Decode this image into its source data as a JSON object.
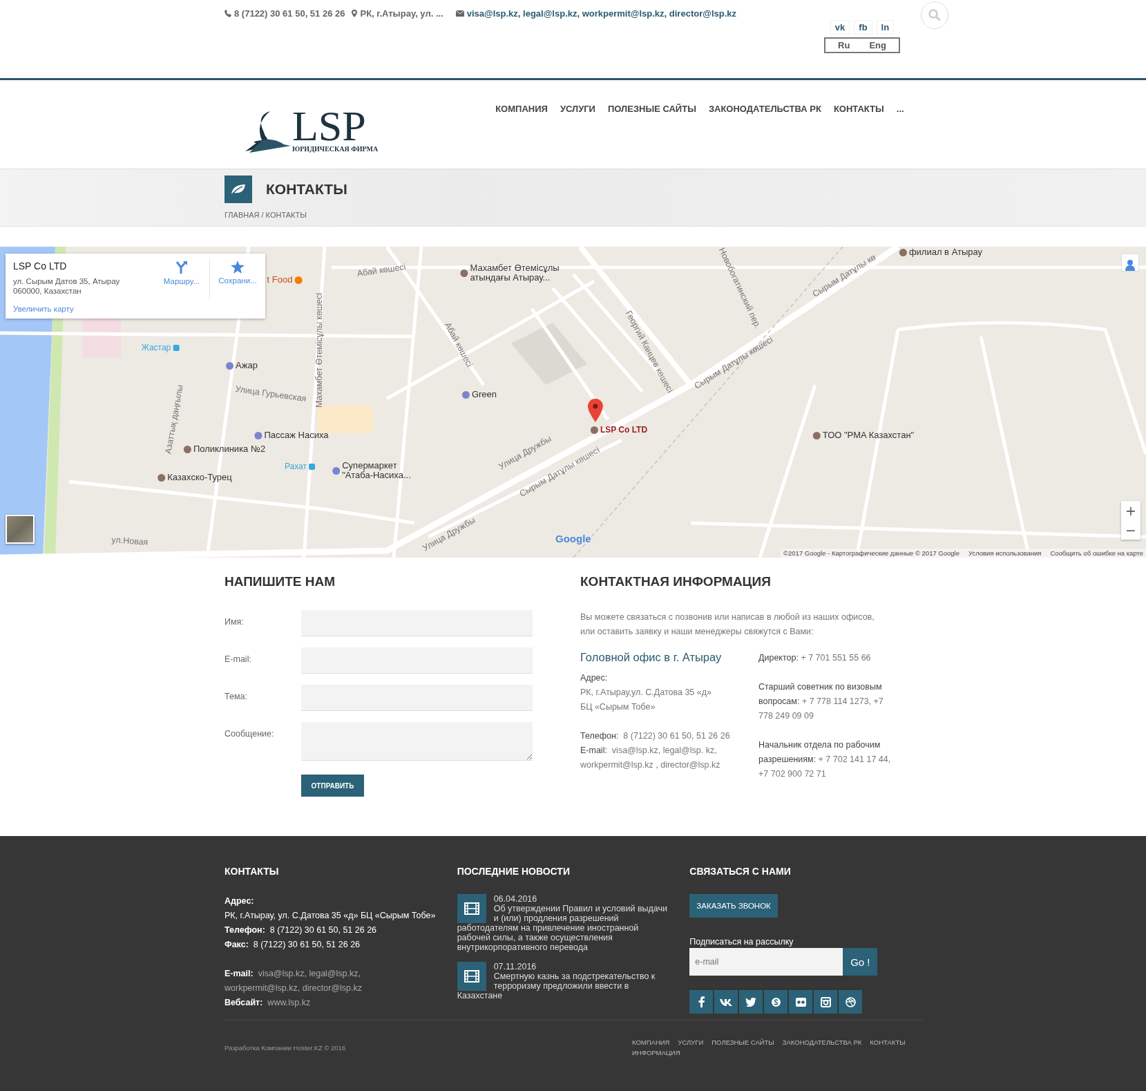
{
  "topbar": {
    "phone": "8 (7122) 30 61 50, 51 26 26",
    "address": "РК, г.Атырау, ул. ...",
    "emails": "visa@lsp.kz, legal@lsp.kz, workpermit@lsp.kz, director@lsp.kz",
    "social": [
      "vk",
      "fb",
      "ln"
    ],
    "languages": [
      "Ru",
      "Eng"
    ]
  },
  "logo": {
    "name": "LSP",
    "tagline": "ЮРИДИЧЕСКАЯ ФИРМА"
  },
  "nav": [
    "КОМПАНИЯ",
    "УСЛУГИ",
    "ПОЛЕЗНЫЕ САЙТЫ",
    "ЗАКОНОДАТЕЛЬСТВА РК",
    "КОНТАКТЫ",
    "..."
  ],
  "page_title": "КОНТАКТЫ",
  "breadcrumb": "ГЛАВНАЯ / КОНТАКТЫ",
  "map": {
    "info_card": {
      "title": "LSP Co LTD",
      "address": [
        "ул. Сырым Датов 35, Атырау",
        "060000, Казахстан"
      ],
      "actions": [
        "Маршру...",
        "Сохрани..."
      ],
      "link": "Увеличить карту"
    },
    "labels": [
      {
        "text": "Абай көшесі",
        "kind": "street"
      },
      {
        "text": "t Food",
        "kind": "food"
      },
      {
        "text": "Махамбет Өтемісұлы\nатындағы Атырау...",
        "kind": "poi"
      },
      {
        "text": "филиал в Атырау",
        "kind": "poi"
      },
      {
        "text": "Жастар",
        "kind": "transit"
      },
      {
        "text": "Ажар",
        "kind": "shop"
      },
      {
        "text": "Улица Гурьевская",
        "kind": "street"
      },
      {
        "text": "Махамбет Өтемісұлы көшесі",
        "kind": "street"
      },
      {
        "text": "Абай көшесі",
        "kind": "street"
      },
      {
        "text": "Green",
        "kind": "shop"
      },
      {
        "text": "Георгий Канцев көшесі",
        "kind": "street"
      },
      {
        "text": "Новобогатинский пер.",
        "kind": "street"
      },
      {
        "text": "Сырым Датұлы кө",
        "kind": "street"
      },
      {
        "text": "Сырым Датұлы көшесі",
        "kind": "street"
      },
      {
        "text": "Пассаж Насиха",
        "kind": "shop"
      },
      {
        "text": "LSP Co LTD",
        "kind": "marker"
      },
      {
        "text": "ТОО \"PMA Казахстан\"",
        "kind": "poi"
      },
      {
        "text": "Поликлиника №2",
        "kind": "poi"
      },
      {
        "text": "Рахат",
        "kind": "transit"
      },
      {
        "text": "Супермаркет\n\"Атаба-Насиха...",
        "kind": "shop"
      },
      {
        "text": "Казахско-Турец",
        "kind": "poi"
      },
      {
        "text": "Азаттық даңғылы",
        "kind": "street"
      },
      {
        "text": "Улица Дружбы",
        "kind": "street"
      },
      {
        "text": "Сырым Датұлы көшесі",
        "kind": "street"
      },
      {
        "text": "Улица Дружбы",
        "kind": "street"
      },
      {
        "text": "ул.Новая",
        "kind": "street"
      }
    ],
    "logo": "Google",
    "attribution": [
      "©2017 Google - Картографические данные © 2017 Google",
      "Условия использования",
      "Сообщить об ошибке на карте"
    ],
    "zoom": [
      "+",
      "−"
    ]
  },
  "form": {
    "title": "НАПИШИТЕ НАМ",
    "fields": [
      {
        "label": "Имя:",
        "kind": "input"
      },
      {
        "label": "E-mail:",
        "kind": "input"
      },
      {
        "label": "Тема:",
        "kind": "input"
      },
      {
        "label": "Сообщение:",
        "kind": "textarea"
      }
    ],
    "submit": "ОТПРАВИТЬ"
  },
  "contact_info": {
    "title": "КОНТАКТНАЯ ИНФОРМАЦИЯ",
    "intro": "Вы можете связаться с позвонив или написав в любой из наших офисов, или оставить заявку и наши менеджеры свяжутся с Вами:",
    "office": "Головной офис в г. Атырау",
    "address_label": "Адрес:",
    "address": [
      "РК, г.Атырау,ул. С.Датова 35 «д»",
      "БЦ «Сырым Тобе»"
    ],
    "lines": [
      {
        "label": "Телефон:",
        "value": "8 (7122) 30 61 50, 51 26 26"
      },
      {
        "label": "E-mail:",
        "value": "visa@lsp.kz, legal@lsp. kz, workpermit@lsp.kz , director@lsp.kz"
      }
    ],
    "people": [
      {
        "label": "Директор:",
        "value": "+ 7 701 551 55 66"
      },
      {
        "label": "Старший советник по визовым вопросам:",
        "value": "+ 7 778 114 1273, +7 778 249 09 09"
      },
      {
        "label": "Начальник отдела по рабочим разрешениям:",
        "value": "+ 7 702 141 17 44, +7 702 900 72 71"
      }
    ]
  },
  "footer": {
    "contacts": {
      "title": "КОНТАКТЫ",
      "address_label": "Адрес:",
      "address": "РК, г.Атырау, ул. С.Датова 35 «д» БЦ «Сырым Тобе»",
      "lines": [
        {
          "label": "Телефон:",
          "value": "8 (7122) 30 61 50, 51 26 26"
        },
        {
          "label": "Факс:",
          "value": "8 (7122) 30 61 50, 51 26 26"
        }
      ],
      "links": [
        {
          "label": "E-mail:",
          "value": "visa@lsp.kz, legal@lsp.kz, workpermit@lsp.kz, director@lsp.kz"
        },
        {
          "label": "Вебсайт:",
          "value": "www.lsp.kz"
        }
      ]
    },
    "news": {
      "title": "ПОСЛЕДНИЕ НОВОСТИ",
      "items": [
        {
          "date": "06.04.2016",
          "text": "Об утверждении Правил и условий выдачи и (или) продления разрешений работодателям на привлечение иностранной рабочей силы, а также осуществления внутрикорпоративного перевода"
        },
        {
          "date": "07.11.2016",
          "text": "Смертную казнь за подстрекательство к терроризму предложили ввести в Казахстане"
        }
      ]
    },
    "connect": {
      "title": "СВЯЗАТЬСЯ С НАМИ",
      "callback": "ЗАКАЗАТЬ ЗВОНОК",
      "subscribe_label": "Подписаться на рассылку",
      "placeholder": "e-mail",
      "go": "Go !"
    },
    "credit": "Разработка Компании Hoster.KZ © 2016",
    "menu": [
      "КОМПАНИЯ",
      "УСЛУГИ",
      "ПОЛЕЗНЫЕ САЙТЫ",
      "ЗАКОНОДАТЕЛЬСТВА РК",
      "КОНТАКТЫ",
      "ИНФОРМАЦИЯ"
    ]
  }
}
